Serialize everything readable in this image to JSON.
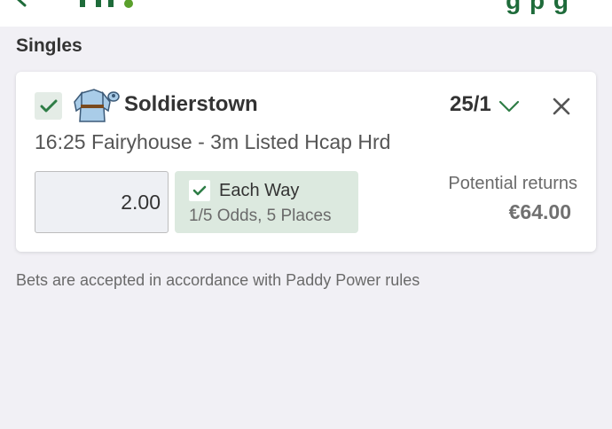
{
  "section": {
    "title": "Singles"
  },
  "bet": {
    "selected": true,
    "silks_icon": "jockey-silks-icon",
    "runner": "Soldierstown",
    "odds": "25/1",
    "event": "16:25 Fairyhouse - 3m Listed Hcap Hrd",
    "stake": "2.00",
    "each_way": {
      "checked": true,
      "label": "Each Way",
      "terms": "1/5 Odds, 5 Places"
    },
    "returns_label": "Potential returns",
    "returns_value": "€64.00"
  },
  "footer": {
    "note": "Bets are accepted in accordance with Paddy Power rules"
  },
  "colors": {
    "accent_green": "#1e6b3a",
    "check_green": "#2e7d46",
    "background": "#f1f0f5",
    "each_way_bg": "#dce9df"
  }
}
